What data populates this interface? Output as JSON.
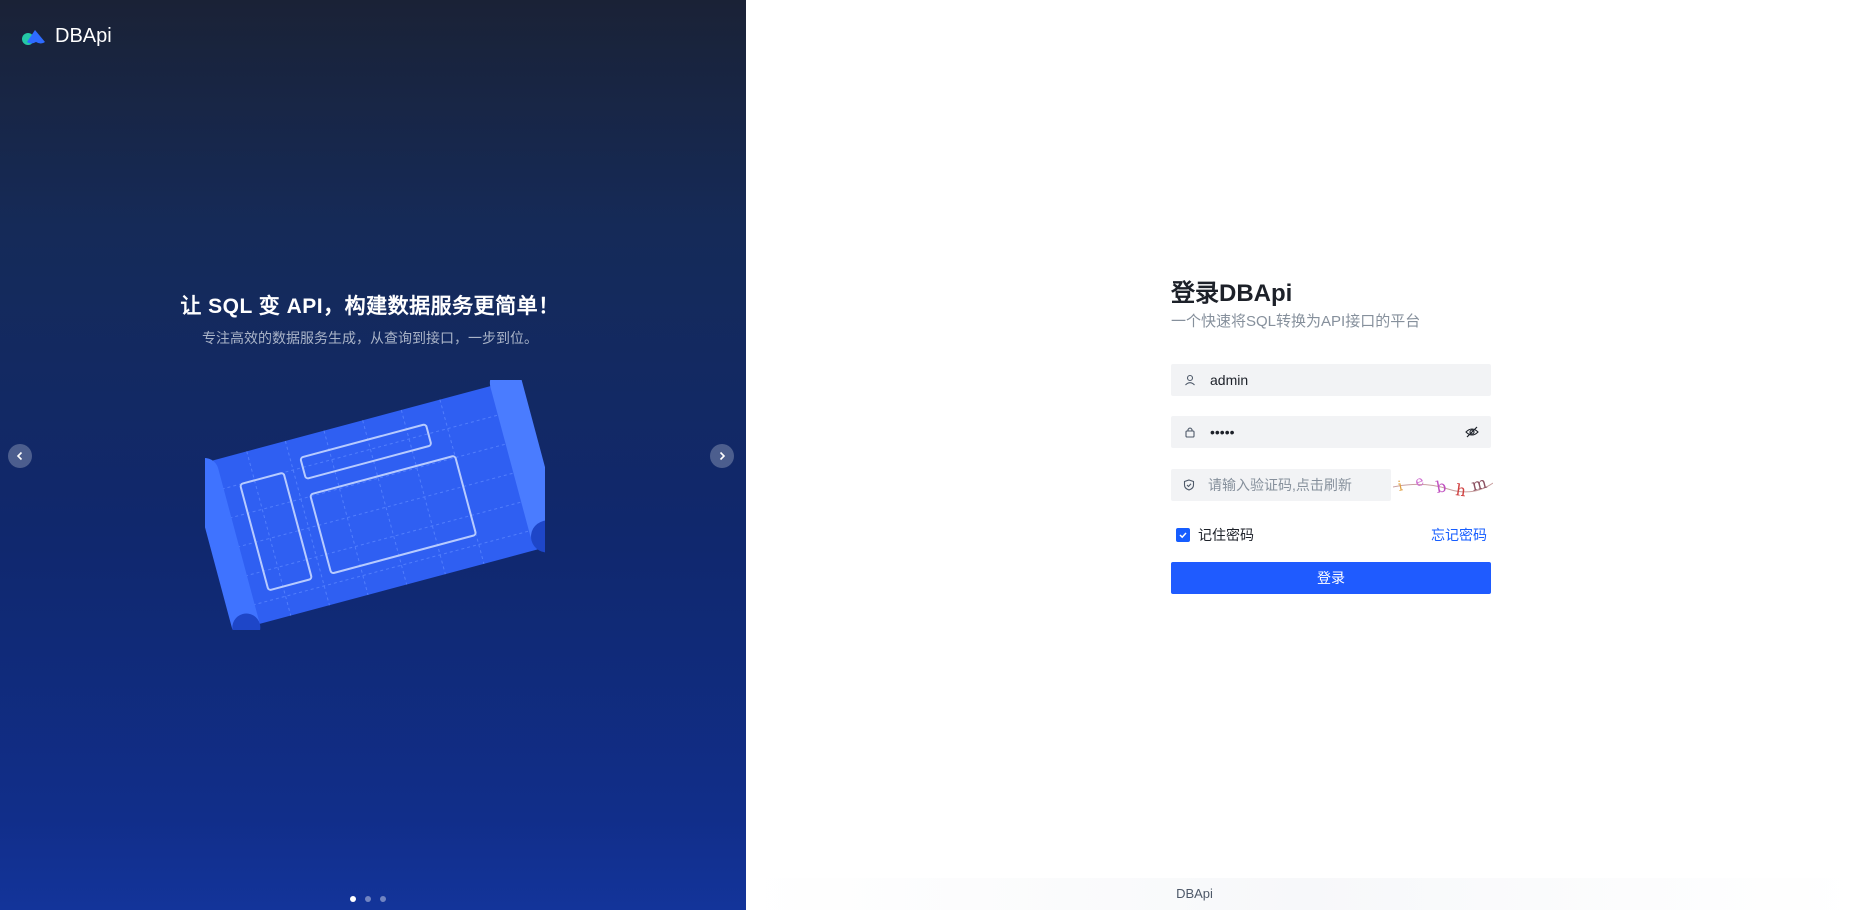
{
  "brand": {
    "name": "DBApi"
  },
  "carousel": {
    "title": "让 SQL 变 API，构建数据服务更简单！",
    "subtitle": "专注高效的数据服务生成，从查询到接口，一步到位。",
    "dot_count": 3,
    "active_index": 0
  },
  "login": {
    "title": "登录DBApi",
    "subtitle": "一个快速将SQL转换为API接口的平台",
    "username_value": "admin",
    "password_value": "•••••",
    "captcha_placeholder": "请输入验证码,点击刷新",
    "captcha_text": "iebhm",
    "remember_label": "记住密码",
    "remember_checked": true,
    "forgot_label": "忘记密码",
    "submit_label": "登录"
  },
  "footer": {
    "text": "DBApi"
  },
  "colors": {
    "primary": "#165dff",
    "button": "#1f5bff",
    "input_bg": "#f2f3f5"
  }
}
